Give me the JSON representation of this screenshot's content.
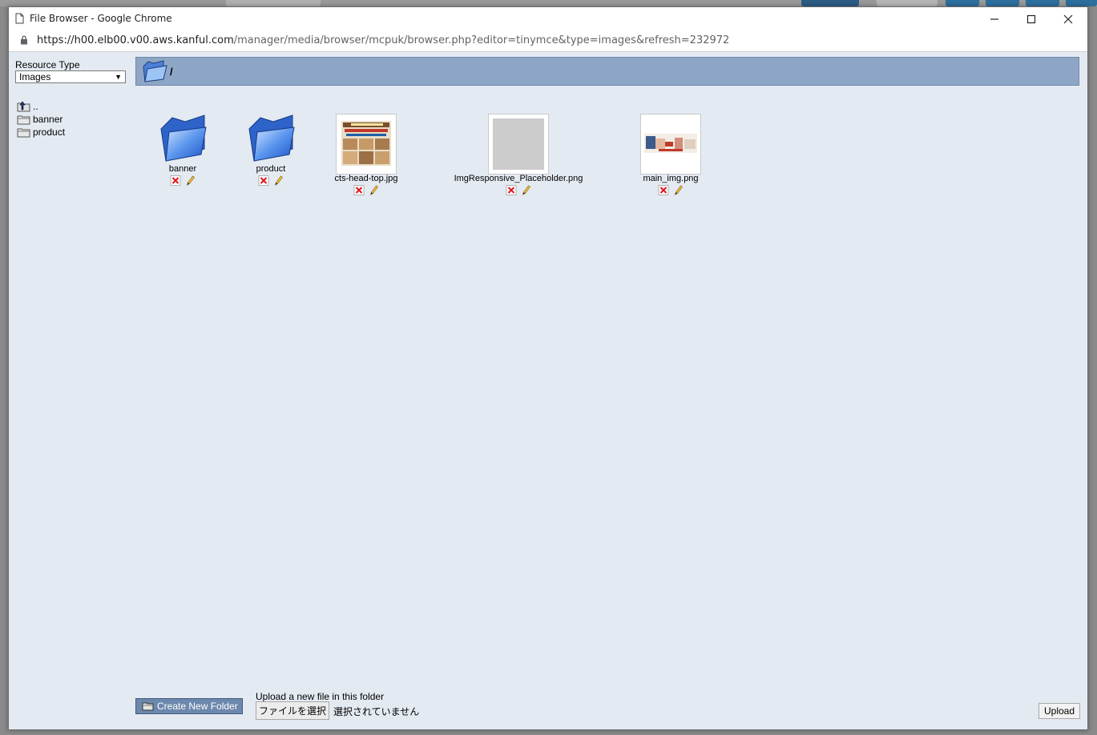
{
  "window": {
    "title": "File Browser - Google Chrome",
    "url_host": "https://h00.elb00.v00.aws.kanful.com",
    "url_path": "/manager/media/browser/mcpuk/browser.php?editor=tinymce&type=images&refresh=232972"
  },
  "sidebar": {
    "resource_type_label": "Resource Type",
    "resource_type_value": "Images",
    "tree": [
      {
        "label": ".."
      },
      {
        "label": "banner"
      },
      {
        "label": "product"
      }
    ]
  },
  "path": "/",
  "items": [
    {
      "name": "banner",
      "kind": "folder"
    },
    {
      "name": "product",
      "kind": "folder"
    },
    {
      "name": "cts-head-top.jpg",
      "kind": "image"
    },
    {
      "name": "ImgResponsive_Placeholder.png",
      "kind": "image"
    },
    {
      "name": "main_img.png",
      "kind": "image"
    }
  ],
  "footer": {
    "create_folder_label": "Create New Folder",
    "upload_label": "Upload a new file in this folder",
    "choose_file_label": "ファイルを選択",
    "no_file_label": "選択されていません",
    "upload_button": "Upload"
  },
  "colors": {
    "path_bar": "#8ea6c6",
    "content_bg": "#e4eaf2",
    "create_button": "#6d88ad"
  }
}
